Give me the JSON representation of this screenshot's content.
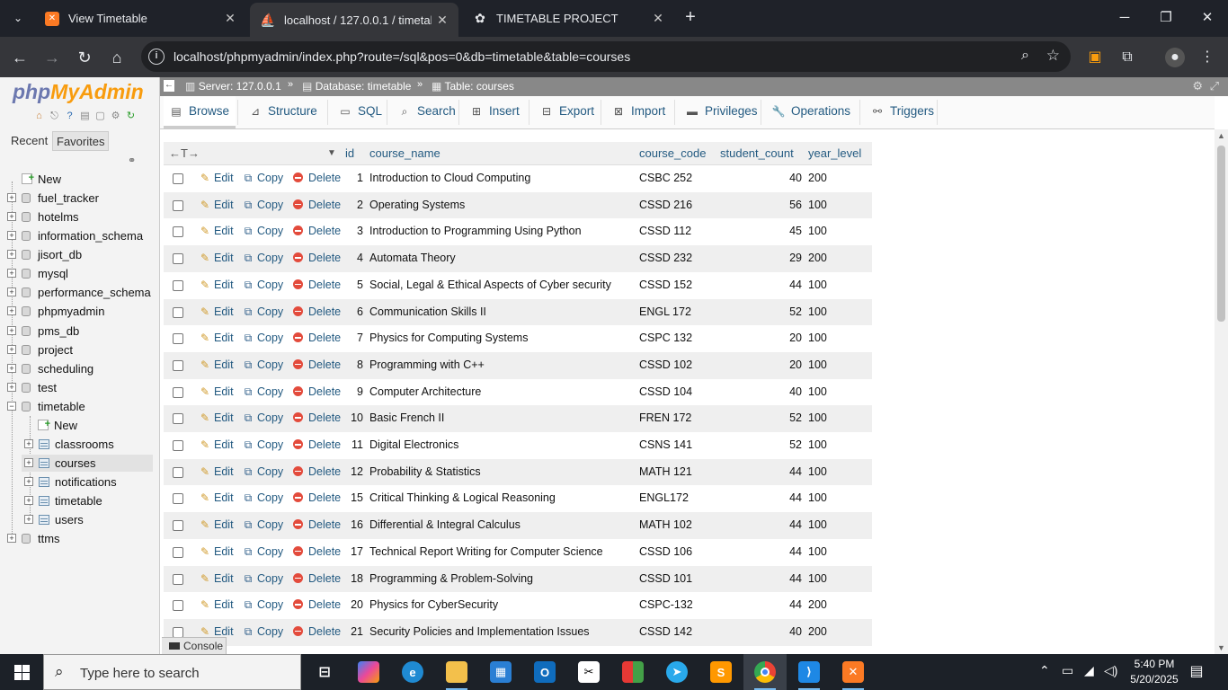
{
  "browser": {
    "tabs": [
      {
        "title": "View Timetable",
        "favicon": "xampp-icon"
      },
      {
        "title": "localhost / 127.0.0.1 / timetable",
        "favicon": "phpmyadmin-icon"
      },
      {
        "title": "TIMETABLE PROJECT",
        "favicon": "chatgpt-icon"
      }
    ],
    "url": "localhost/phpmyadmin/index.php?route=/sql&pos=0&db=timetable&table=courses"
  },
  "pma": {
    "logo_a": "php",
    "logo_b": "MyAdmin",
    "recent_label": "Recent",
    "favorites_label": "Favorites",
    "tree": {
      "new_label": "New",
      "databases": [
        "fuel_tracker",
        "hotelms",
        "information_schema",
        "jisort_db",
        "mysql",
        "performance_schema",
        "phpmyadmin",
        "pms_db",
        "project",
        "scheduling",
        "test",
        "timetable"
      ],
      "timetable_children_new": "New",
      "timetable_tables": [
        "classrooms",
        "courses",
        "notifications",
        "timetable",
        "users"
      ],
      "last_db": "ttms"
    },
    "breadcrumb": {
      "server": "Server: 127.0.0.1",
      "database": "Database: timetable",
      "table": "Table: courses"
    },
    "menu": [
      "Browse",
      "Structure",
      "SQL",
      "Search",
      "Insert",
      "Export",
      "Import",
      "Privileges",
      "Operations",
      "Triggers"
    ],
    "grid": {
      "headers": [
        "id",
        "course_name",
        "course_code",
        "student_count",
        "year_level"
      ],
      "actions": {
        "edit": "Edit",
        "copy": "Copy",
        "delete": "Delete"
      },
      "rows": [
        {
          "id": "1",
          "name": "Introduction to Cloud Computing",
          "code": "CSBC 252",
          "count": "40",
          "year": "200"
        },
        {
          "id": "2",
          "name": "Operating Systems",
          "code": "CSSD 216",
          "count": "56",
          "year": "100"
        },
        {
          "id": "3",
          "name": "Introduction to Programming Using Python",
          "code": "CSSD 112",
          "count": "45",
          "year": "100"
        },
        {
          "id": "4",
          "name": "Automata Theory",
          "code": "CSSD 232",
          "count": "29",
          "year": "200"
        },
        {
          "id": "5",
          "name": "Social, Legal & Ethical Aspects of Cyber security",
          "code": "CSSD 152",
          "count": "44",
          "year": "100"
        },
        {
          "id": "6",
          "name": "Communication Skills II",
          "code": "ENGL 172",
          "count": "52",
          "year": "100"
        },
        {
          "id": "7",
          "name": "Physics for Computing Systems",
          "code": "CSPC 132",
          "count": "20",
          "year": "100"
        },
        {
          "id": "8",
          "name": "Programming with C++",
          "code": "CSSD 102",
          "count": "20",
          "year": "100"
        },
        {
          "id": "9",
          "name": "Computer Architecture",
          "code": "CSSD 104",
          "count": "40",
          "year": "100"
        },
        {
          "id": "10",
          "name": "Basic French II",
          "code": "FREN 172",
          "count": "52",
          "year": "100"
        },
        {
          "id": "11",
          "name": "Digital Electronics",
          "code": "CSNS 141",
          "count": "52",
          "year": "100"
        },
        {
          "id": "12",
          "name": "Probability & Statistics",
          "code": "MATH 121",
          "count": "44",
          "year": "100"
        },
        {
          "id": "15",
          "name": "Critical Thinking & Logical Reasoning",
          "code": "ENGL172",
          "count": "44",
          "year": "100"
        },
        {
          "id": "16",
          "name": "Differential & Integral Calculus",
          "code": "MATH 102",
          "count": "44",
          "year": "100"
        },
        {
          "id": "17",
          "name": "Technical Report Writing for Computer Science",
          "code": "CSSD 106",
          "count": "44",
          "year": "100"
        },
        {
          "id": "18",
          "name": "Programming & Problem-Solving",
          "code": "CSSD 101",
          "count": "44",
          "year": "100"
        },
        {
          "id": "20",
          "name": "Physics for CyberSecurity",
          "code": "CSPC-132",
          "count": "44",
          "year": "200"
        },
        {
          "id": "21",
          "name": "Security Policies and Implementation Issues",
          "code": "CSSD 142",
          "count": "40",
          "year": "200"
        }
      ]
    },
    "console_label": "Console"
  },
  "taskbar": {
    "search_placeholder": "Type here to search",
    "time": "5:40 PM",
    "date": "5/20/2025"
  }
}
